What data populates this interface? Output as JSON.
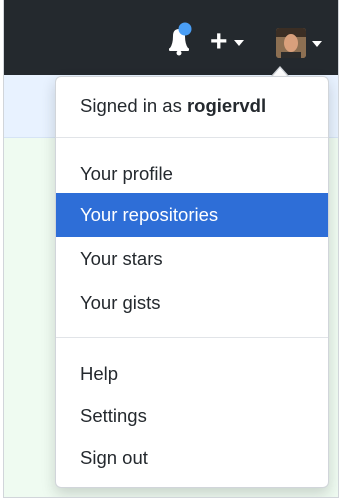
{
  "header": {
    "notification_icon": "bell-icon",
    "notification_dot_color": "#4a9ef5",
    "create_icon": "plus-icon",
    "avatar_icon": "user-avatar"
  },
  "menu": {
    "signed_in_prefix": "Signed in as ",
    "username": "rogiervdl",
    "items": [
      {
        "label": "Your profile"
      },
      {
        "label": "Your repositories",
        "active": true
      },
      {
        "label": "Your stars"
      },
      {
        "label": "Your gists"
      },
      {
        "label": "Help"
      },
      {
        "label": "Settings"
      },
      {
        "label": "Sign out"
      }
    ],
    "active_color": "#2e6ed7"
  }
}
